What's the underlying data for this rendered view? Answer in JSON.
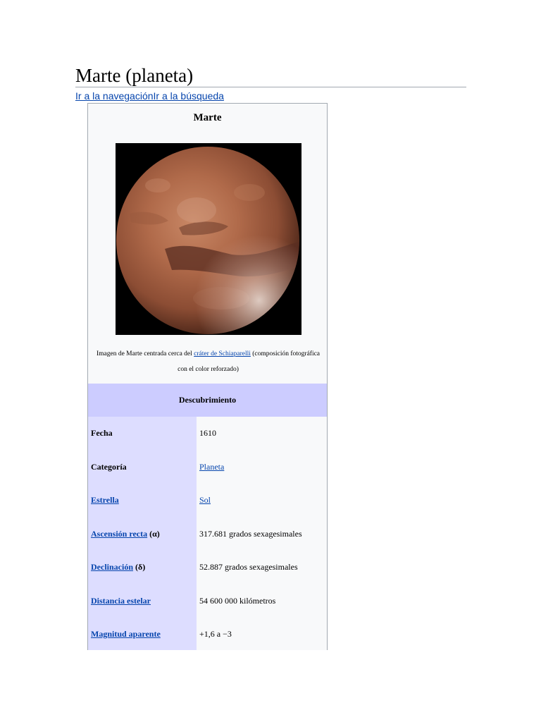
{
  "page": {
    "title": "Marte (planeta)",
    "nav_link_1": "Ir a la navegación",
    "nav_link_2": "Ir a la búsqueda"
  },
  "infobox": {
    "title": "Marte",
    "image_alt": "planet-mars-photo",
    "caption_before": "Imagen de Marte centrada cerca del ",
    "caption_link": "cráter de Schiaparelli",
    "caption_after": " (composición fotográfica con el color reforzado)",
    "section_header": "Descubrimiento",
    "rows": [
      {
        "label": "Fecha",
        "label_is_link": false,
        "label_suffix": "",
        "value": "1610",
        "value_is_link": false
      },
      {
        "label": "Categoría",
        "label_is_link": false,
        "label_suffix": "",
        "value": "Planeta",
        "value_is_link": true
      },
      {
        "label": "Estrella",
        "label_is_link": true,
        "label_suffix": "",
        "value": "Sol",
        "value_is_link": true
      },
      {
        "label": "Ascensión recta",
        "label_is_link": true,
        "label_suffix": " (α)",
        "value": "317.681 grados sexagesimales",
        "value_is_link": false
      },
      {
        "label": "Declinación",
        "label_is_link": true,
        "label_suffix": " (δ)",
        "value": "52.887 grados sexagesimales",
        "value_is_link": false
      },
      {
        "label": "Distancia estelar",
        "label_is_link": true,
        "label_suffix": "",
        "value": "54 600 000 kilómetros",
        "value_is_link": false
      },
      {
        "label": "Magnitud aparente",
        "label_is_link": true,
        "label_suffix": "",
        "value": "+1,6 a −3",
        "value_is_link": false
      }
    ]
  },
  "colors": {
    "link": "#0645ad",
    "header_bg": "#ccccff",
    "label_bg": "#ddddff",
    "box_bg": "#f8f9fa"
  }
}
